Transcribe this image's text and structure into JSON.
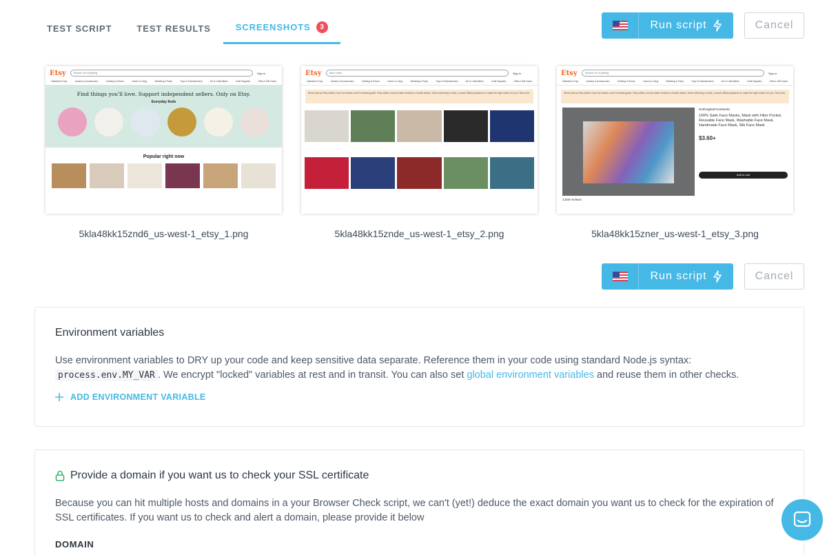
{
  "tabs": [
    {
      "label": "TEST SCRIPT"
    },
    {
      "label": "TEST RESULTS"
    },
    {
      "label": "SCREENSHOTS",
      "badge": "3"
    }
  ],
  "actions": {
    "run_label": "Run script",
    "cancel_label": "Cancel",
    "flag_icon": "us-flag-icon",
    "run_icon": "lightning-icon"
  },
  "screenshots": [
    {
      "filename": "5kla48kk15znd6_us-west-1_etsy_1.png"
    },
    {
      "filename": "5kla48kk15znde_us-west-1_etsy_2.png"
    },
    {
      "filename": "5kla48kk15zner_us-west-1_etsy_3.png"
    }
  ],
  "etsy": {
    "logo": "Etsy",
    "search_placeholder": "Search for anything",
    "search_query": "face mask",
    "signin": "Sign in",
    "nav": [
      "Valentine's Day",
      "Jewelry & Accessories",
      "Clothing & Shoes",
      "Home & Living",
      "Wedding & Party",
      "Toys & Entertainment",
      "Art & Collectibles",
      "Craft Supplies",
      "Gifts & Gift Cards"
    ],
    "hero_title": "Find things you'll love. Support independent sellers. Only on Etsy.",
    "hero_sub": "Everyday finds",
    "popular": "Popular right now",
    "notice": "Items sold by Etsy sellers, such as masks, aren't medical-grade. Etsy sellers cannot make medical or health claims. When selecting a mask, consult official guidance to make the right choice for you. More info",
    "shop_name": "NothingButFaceMasks",
    "listing_title": "100% Satin Face Masks, Mask with Filter Pocket, Reusable Face Mask, Washable Face Mask, Handmade Face Mask, Silk Face Mask",
    "price": "$3.60+",
    "add_to_cart": "Add to cart",
    "reviews": "3,849 reviews"
  },
  "env": {
    "title": "Environment variables",
    "text1": "Use environment variables to DRY up your code and keep sensitive data separate. Reference them in your code using standard Node.js syntax:",
    "code": "process.env.MY_VAR",
    "text2": ". We encrypt \"locked\" variables at rest and in transit. You can also set",
    "link": "global environment variables",
    "text3": "and reuse them in other checks.",
    "add_label": "ADD ENVIRONMENT VARIABLE"
  },
  "ssl": {
    "title": "Provide a domain if you want us to check your SSL certificate",
    "text": "Because you can hit multiple hosts and domains in a your Browser Check script, we can't (yet!) deduce the exact domain you want us to check for the expiration of SSL certificates. If you want us to check and alert a domain, please provide it below",
    "domain_label": "DOMAIN"
  },
  "colors": {
    "accent": "#45b8e6",
    "badge": "#ef4f5d",
    "etsy_orange": "#f1641e"
  }
}
